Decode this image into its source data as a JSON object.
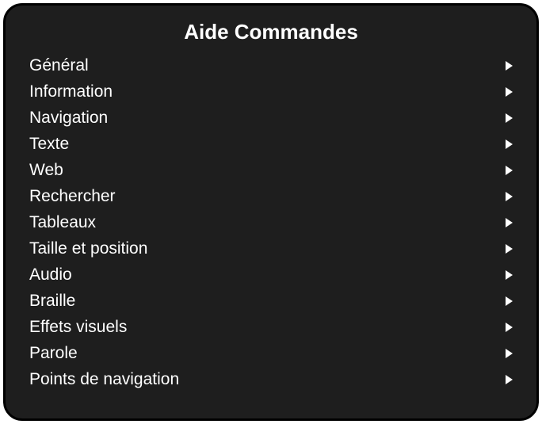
{
  "panel": {
    "title": "Aide Commandes",
    "items": [
      {
        "label": "Général"
      },
      {
        "label": "Information"
      },
      {
        "label": "Navigation"
      },
      {
        "label": "Texte"
      },
      {
        "label": "Web"
      },
      {
        "label": "Rechercher"
      },
      {
        "label": "Tableaux"
      },
      {
        "label": "Taille et position"
      },
      {
        "label": "Audio"
      },
      {
        "label": "Braille"
      },
      {
        "label": "Effets visuels"
      },
      {
        "label": "Parole"
      },
      {
        "label": "Points de navigation"
      }
    ]
  }
}
